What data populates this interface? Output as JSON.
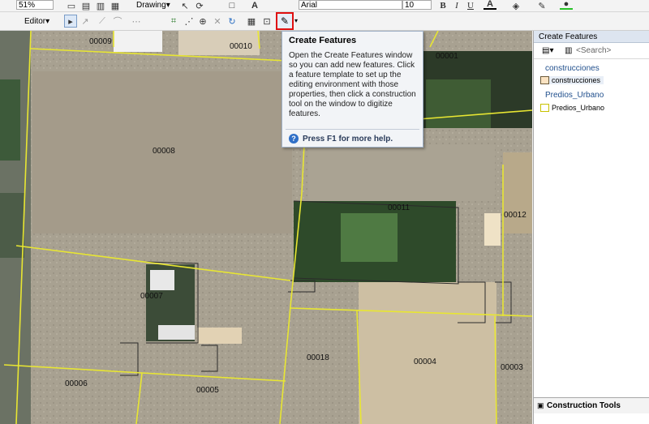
{
  "toolbar_top": {
    "zoom_value": "51%",
    "drawing_label": "Drawing",
    "font_name": "Arial",
    "font_size": "10",
    "bold": "B",
    "italic": "I",
    "underline": "U",
    "text_tool": "A"
  },
  "toolbar_editor": {
    "editor_label": "Editor"
  },
  "map": {
    "parcel_labels": [
      "00009",
      "00010",
      "00001",
      "00008",
      "00011",
      "00012",
      "00007",
      "00018",
      "00004",
      "00003",
      "00006",
      "00005"
    ],
    "parcel_line_color": "#e8e632"
  },
  "tooltip": {
    "title": "Create Features",
    "body": "Open the Create Features window so you can add new features. Click a feature template to set up the editing environment with those properties, then click a construction tool on the window to digitize features.",
    "help": "Press F1 for more help."
  },
  "panel": {
    "title": "Create Features",
    "search_placeholder": "<Search>",
    "groups": [
      {
        "name": "construcciones",
        "template": "construcciones",
        "fill": "#fbe3c2",
        "stroke": "#6b5a3a"
      },
      {
        "name": "Predios_Urbano",
        "template": "Predios_Urbano",
        "fill": "#ffffff",
        "stroke": "#c8c200"
      }
    ]
  },
  "construction_tools": {
    "label": "Construction Tools"
  }
}
